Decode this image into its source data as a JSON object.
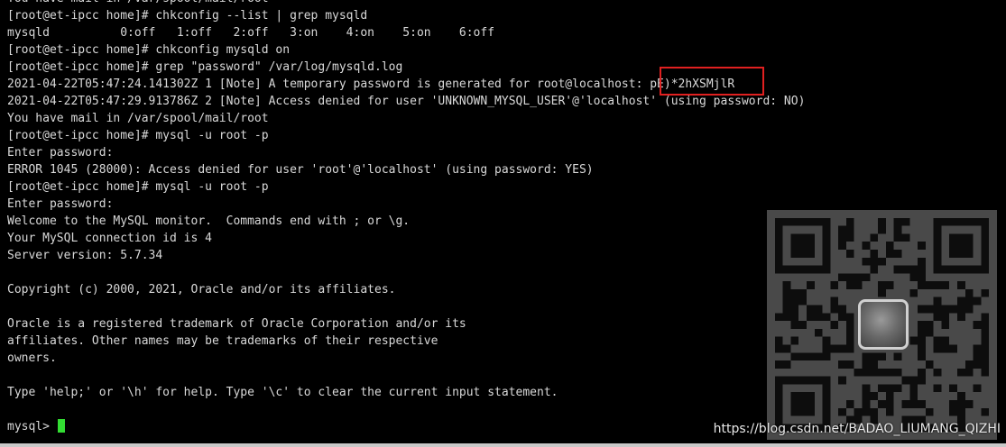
{
  "terminal": {
    "lines": [
      "You have mail in /var/spool/mail/root",
      "[root@et-ipcc home]# chkconfig --list | grep mysqld",
      "mysqld          0:off   1:off   2:off   3:on    4:on    5:on    6:off",
      "[root@et-ipcc home]# chkconfig mysqld on",
      "[root@et-ipcc home]# grep \"password\" /var/log/mysqld.log",
      "2021-04-22T05:47:24.141302Z 1 [Note] A temporary password is generated for root@localhost: pE)*2hXSMjlR",
      "2021-04-22T05:47:29.913786Z 2 [Note] Access denied for user 'UNKNOWN_MYSQL_USER'@'localhost' (using password: NO)",
      "You have mail in /var/spool/mail/root",
      "[root@et-ipcc home]# mysql -u root -p",
      "Enter password:",
      "ERROR 1045 (28000): Access denied for user 'root'@'localhost' (using password: YES)",
      "[root@et-ipcc home]# mysql -u root -p",
      "Enter password:",
      "Welcome to the MySQL monitor.  Commands end with ; or \\g.",
      "Your MySQL connection id is 4",
      "Server version: 5.7.34",
      "",
      "Copyright (c) 2000, 2021, Oracle and/or its affiliates.",
      "",
      "Oracle is a registered trademark of Oracle Corporation and/or its",
      "affiliates. Other names may be trademarks of their respective",
      "owners.",
      "",
      "Type 'help;' or '\\h' for help. Type '\\c' to clear the current input statement.",
      "",
      "mysql> "
    ]
  },
  "watermark": "https://blog.csdn.net/BADAO_LIUMANG_QIZHI",
  "colors": {
    "background": "#000000",
    "text": "#d9d9d9",
    "cursor": "#33dd33",
    "highlight": "#e02020"
  }
}
